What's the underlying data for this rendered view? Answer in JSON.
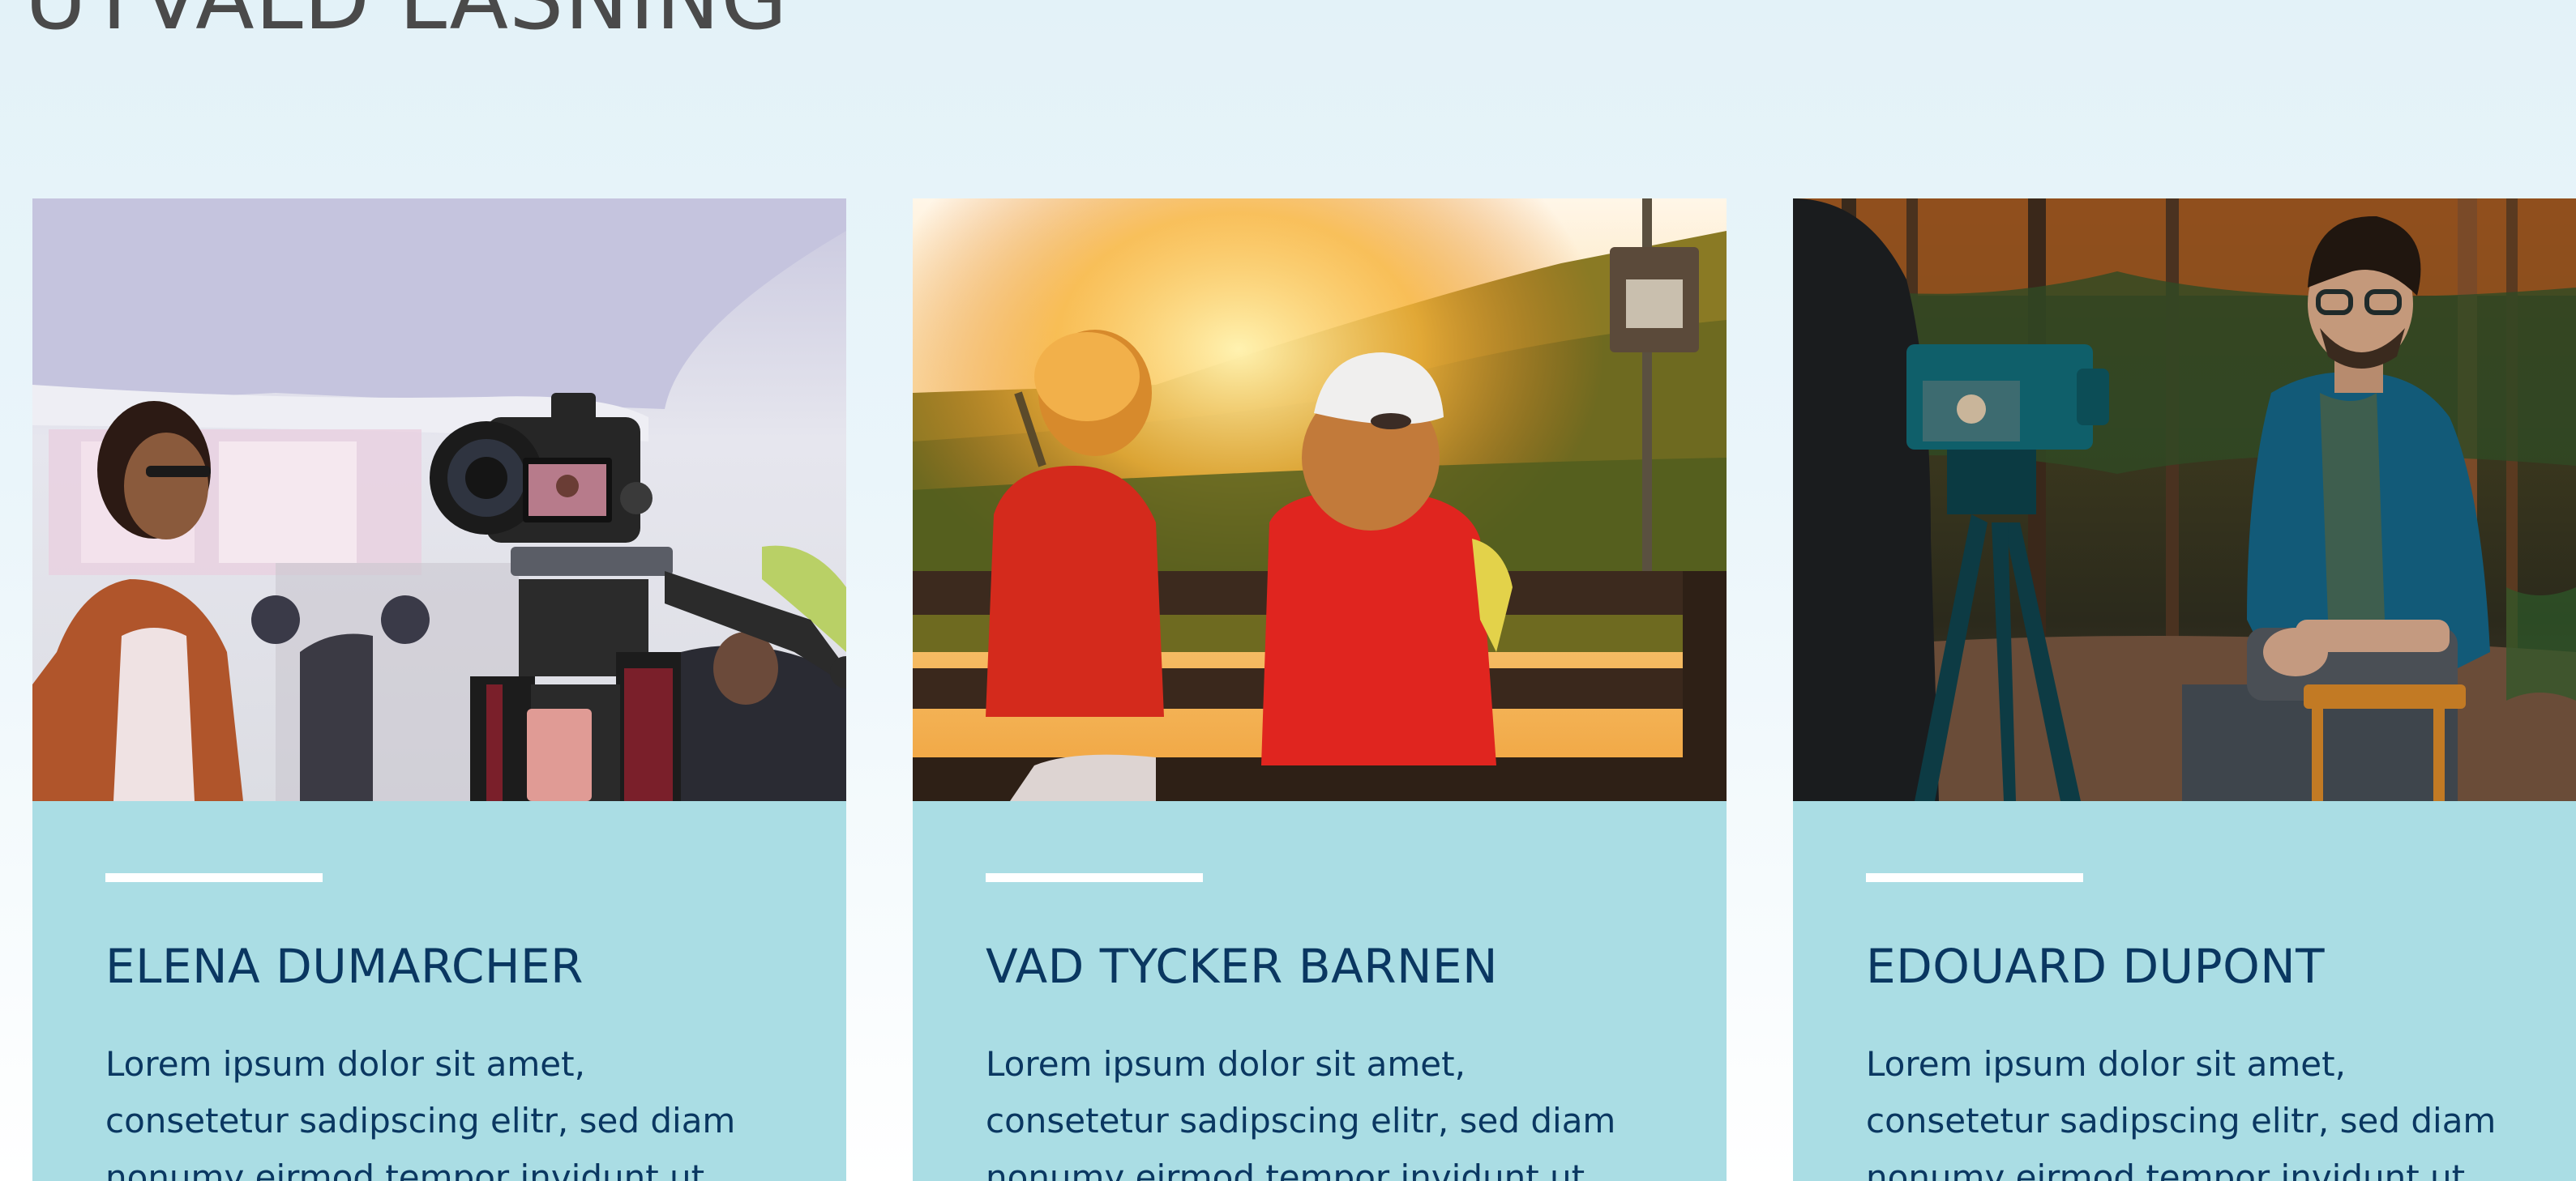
{
  "section": {
    "title": "UTVALD LÄSNING"
  },
  "colors": {
    "background": "#e6f4f9",
    "card_body": "#aadde4",
    "title_text": "#0a3761",
    "heading_text": "#4a4a4a",
    "rule": "#ffffff"
  },
  "cards": [
    {
      "image_alt": "Camera on tripod filming a woman at an event",
      "title": "ELENA DUMARCHER",
      "text": "Lorem ipsum dolor sit amet, consetetur sadipscing elitr, sed diam nonumy eirmod tempor invidunt ut"
    },
    {
      "image_alt": "Two children sitting on a bench at sunset",
      "title": "VAD TYCKER BARNEN",
      "text": "Lorem ipsum dolor sit amet, consetetur sadipscing elitr, sed diam nonumy eirmod tempor invidunt ut"
    },
    {
      "image_alt": "Man in teal cardigan seated in front of a camera in a forest",
      "title": "EDOUARD DUPONT",
      "text": "Lorem ipsum dolor sit amet, consetetur sadipscing elitr, sed diam nonumy eirmod tempor invidunt ut"
    }
  ]
}
